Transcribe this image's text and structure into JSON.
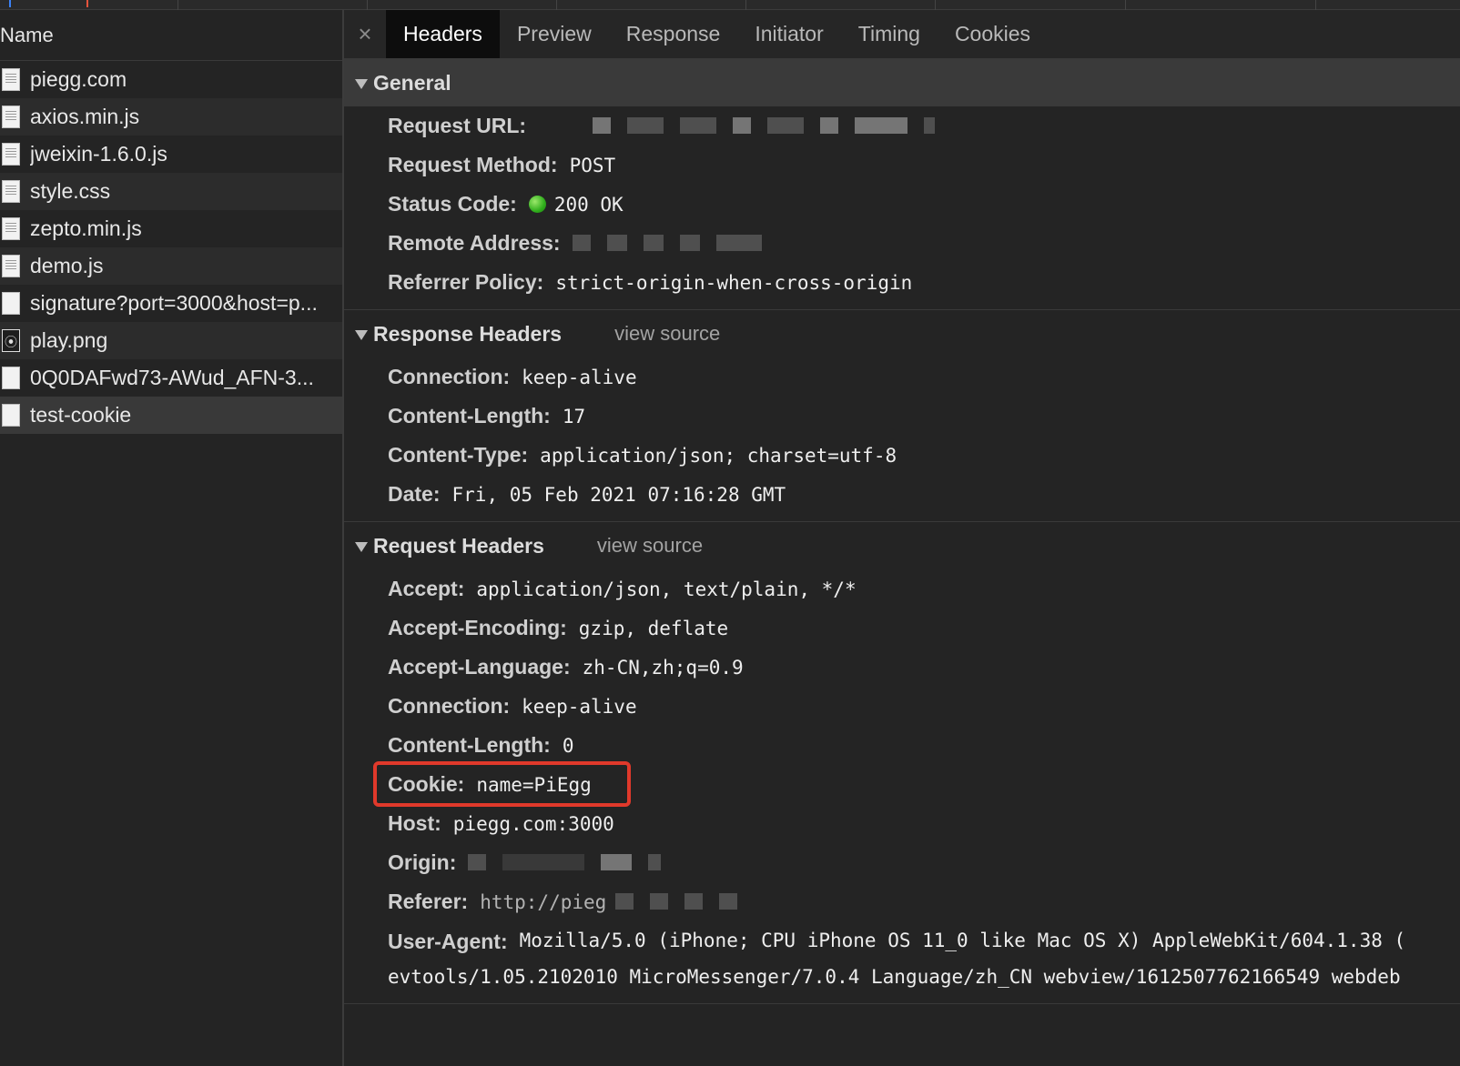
{
  "list": {
    "column_header": "Name",
    "items": [
      {
        "name": "piegg.com",
        "icon": "document-icon"
      },
      {
        "name": "axios.min.js",
        "icon": "script-file-icon"
      },
      {
        "name": "jweixin-1.6.0.js",
        "icon": "script-file-icon"
      },
      {
        "name": "style.css",
        "icon": "stylesheet-file-icon"
      },
      {
        "name": "zepto.min.js",
        "icon": "script-file-icon"
      },
      {
        "name": "demo.js",
        "icon": "script-file-icon"
      },
      {
        "name": "signature?port=3000&host=p...",
        "icon": "blank-file-icon"
      },
      {
        "name": "play.png",
        "icon": "image-file-icon"
      },
      {
        "name": "0Q0DAFwd73-AWud_AFN-3...",
        "icon": "blank-file-icon"
      },
      {
        "name": "test-cookie",
        "icon": "blank-file-icon"
      }
    ]
  },
  "tabs": {
    "close": "×",
    "items": [
      "Headers",
      "Preview",
      "Response",
      "Initiator",
      "Timing",
      "Cookies"
    ],
    "active": "Headers"
  },
  "general": {
    "title": "General",
    "request_url_label": "Request URL:",
    "request_method_label": "Request Method:",
    "request_method": "POST",
    "status_code_label": "Status Code:",
    "status_code": "200 OK",
    "remote_address_label": "Remote Address:",
    "referrer_policy_label": "Referrer Policy:",
    "referrer_policy": "strict-origin-when-cross-origin"
  },
  "response_headers": {
    "title": "Response Headers",
    "view_source": "view source",
    "rows": [
      {
        "key": "Connection:",
        "value": "keep-alive"
      },
      {
        "key": "Content-Length:",
        "value": "17"
      },
      {
        "key": "Content-Type:",
        "value": "application/json; charset=utf-8"
      },
      {
        "key": "Date:",
        "value": "Fri, 05 Feb 2021 07:16:28 GMT"
      }
    ]
  },
  "request_headers": {
    "title": "Request Headers",
    "view_source": "view source",
    "accept_label": "Accept:",
    "accept": "application/json, text/plain, */*",
    "accept_encoding_label": "Accept-Encoding:",
    "accept_encoding": "gzip, deflate",
    "accept_language_label": "Accept-Language:",
    "accept_language": "zh-CN,zh;q=0.9",
    "connection_label": "Connection:",
    "connection": "keep-alive",
    "content_length_label": "Content-Length:",
    "content_length": "0",
    "cookie_label": "Cookie:",
    "cookie": "name=PiEgg",
    "host_label": "Host:",
    "host": "piegg.com:3000",
    "origin_label": "Origin:",
    "referer_label": "Referer:",
    "referer_partial": "http://pieg",
    "user_agent_label": "User-Agent:",
    "user_agent_line1": "Mozilla/5.0 (iPhone; CPU iPhone OS 11_0 like Mac OS X) AppleWebKit/604.1.38 (",
    "user_agent_line2": "evtools/1.05.2102010 MicroMessenger/7.0.4 Language/zh_CN webview/1612507762166549 webdeb"
  },
  "colors": {
    "highlight": "#e0392b",
    "status_ok": "#2fae1c",
    "active_tab_bg": "#0d0d0d"
  }
}
